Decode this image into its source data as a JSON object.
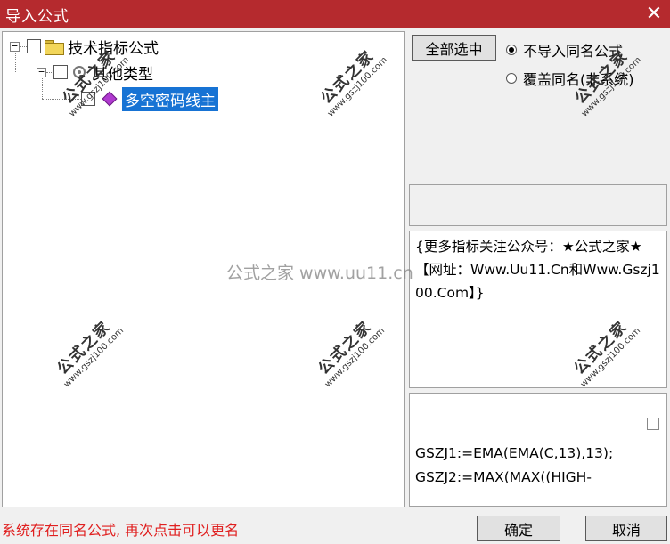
{
  "window": {
    "title": "导入公式",
    "close_glyph": "✕"
  },
  "tree": {
    "root": {
      "expander": "−",
      "label": "技术指标公式"
    },
    "child": {
      "expander": "−",
      "label": "其他类型"
    },
    "leaf": {
      "label": "多空密码线主"
    }
  },
  "options": {
    "select_all_label": "全部选中",
    "radio_no_import": "不导入同名公式",
    "radio_overwrite": "覆盖同名(非系统)",
    "selected": "radio_no_import"
  },
  "description": "{更多指标关注公众号：★公式之家★ 【网址：Www.Uu11.Cn和Www.Gszj100.Com】}",
  "code": {
    "line1": "GSZJ1:=EMA(EMA(C,13),13);",
    "line2": "GSZJ2:=MAX(MAX((HIGH-"
  },
  "status": {
    "message": "系统存在同名公式, 再次点击可以更名",
    "color": "#e02020"
  },
  "buttons": {
    "ok": "确定",
    "cancel": "取消"
  },
  "watermark": {
    "brand": "公式之家",
    "site": "www.gszj100.com",
    "center": "公式之家 www.uu11.cn"
  },
  "colors": {
    "title_bar": "#b52a2e",
    "selection": "#1773d4"
  }
}
